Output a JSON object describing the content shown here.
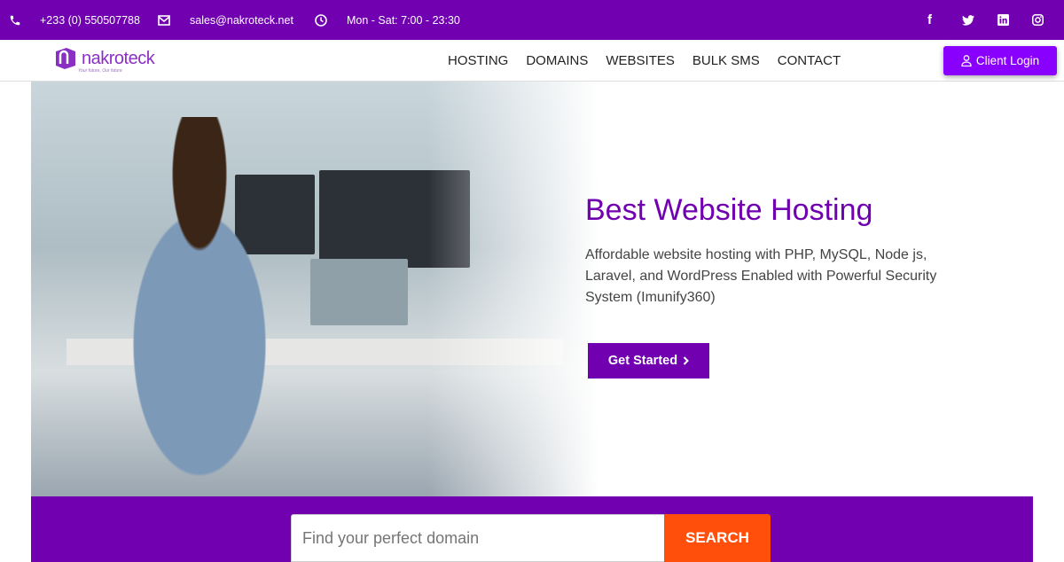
{
  "topbar": {
    "phone": "+233 (0) 550507788",
    "email": "sales@nakroteck.net",
    "hours": "Mon - Sat: 7:00 - 23:30",
    "social": [
      "facebook-icon",
      "twitter-icon",
      "linkedin-icon",
      "instagram-icon"
    ]
  },
  "brand": {
    "name": "nakroteck",
    "tagline": "Your future, Our future"
  },
  "nav": {
    "items": [
      "HOSTING",
      "DOMAINS",
      "WEBSITES",
      "BULK SMS",
      "CONTACT"
    ],
    "login": "Client Login"
  },
  "hero": {
    "title": "Best Website Hosting",
    "subtitle": "Affordable website hosting with PHP, MySQL, Node js, Laravel, and WordPress Enabled with Powerful Security System (Imunify360)",
    "cta": "Get Started"
  },
  "domain_search": {
    "placeholder": "Find your perfect domain",
    "button": "SEARCH"
  },
  "colors": {
    "primary": "#7000b0",
    "login": "#8a00ff",
    "search": "#ff4f0a"
  }
}
